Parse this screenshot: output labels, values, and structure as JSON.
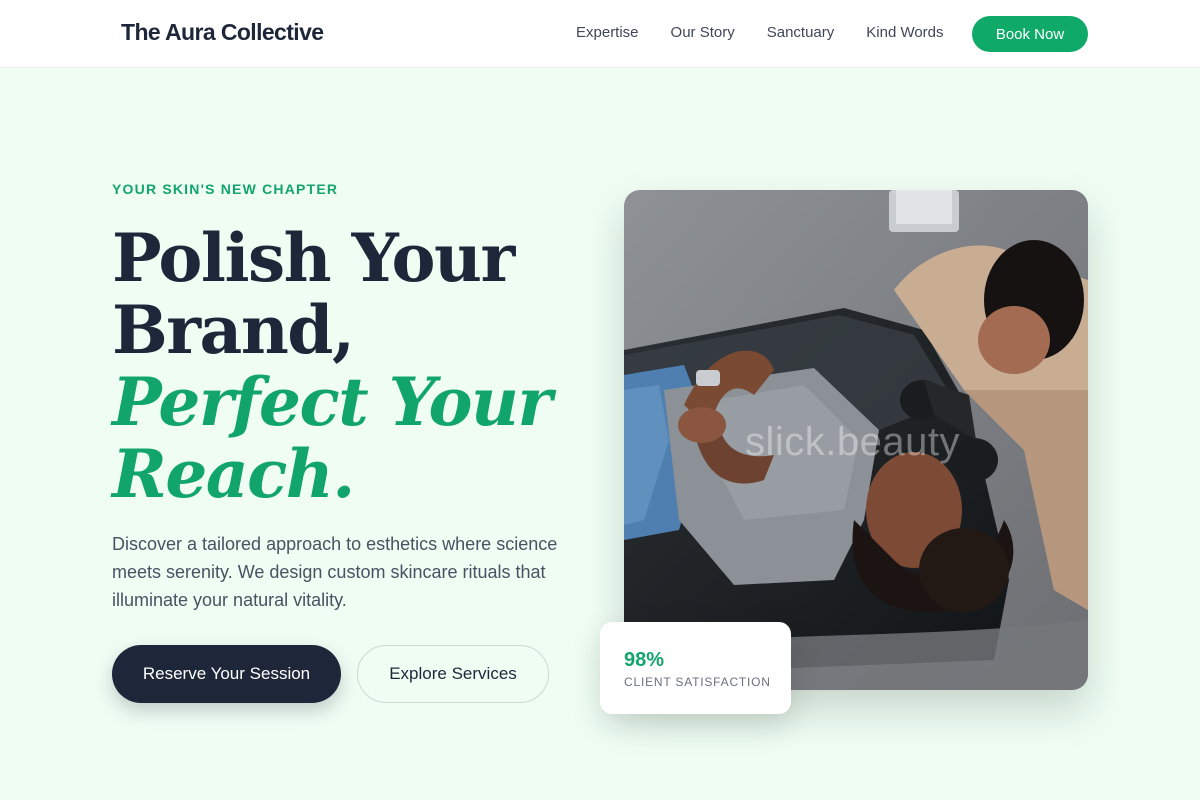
{
  "header": {
    "brand": "The Aura Collective",
    "nav": [
      "Expertise",
      "Our Story",
      "Sanctuary",
      "Kind Words"
    ],
    "book_label": "Book Now"
  },
  "hero": {
    "eyebrow": "YOUR SKIN'S NEW CHAPTER",
    "headline": {
      "line1": "Polish Your",
      "line2": "Brand,",
      "accent_line1": "Perfect Your",
      "accent_line2": "Reach."
    },
    "lede": "Discover a tailored approach to esthetics where science meets serenity. We design custom skincare rituals that illuminate your natural vitality.",
    "primary_cta": "Reserve Your Session",
    "secondary_cta": "Explore Services"
  },
  "media": {
    "watermark": "slick.beauty"
  },
  "stat": {
    "value": "98%",
    "label": "CLIENT SATISFACTION"
  },
  "colors": {
    "brand_green": "#0fa96a",
    "navy": "#1e2639",
    "page_bg": "#effdf3"
  }
}
